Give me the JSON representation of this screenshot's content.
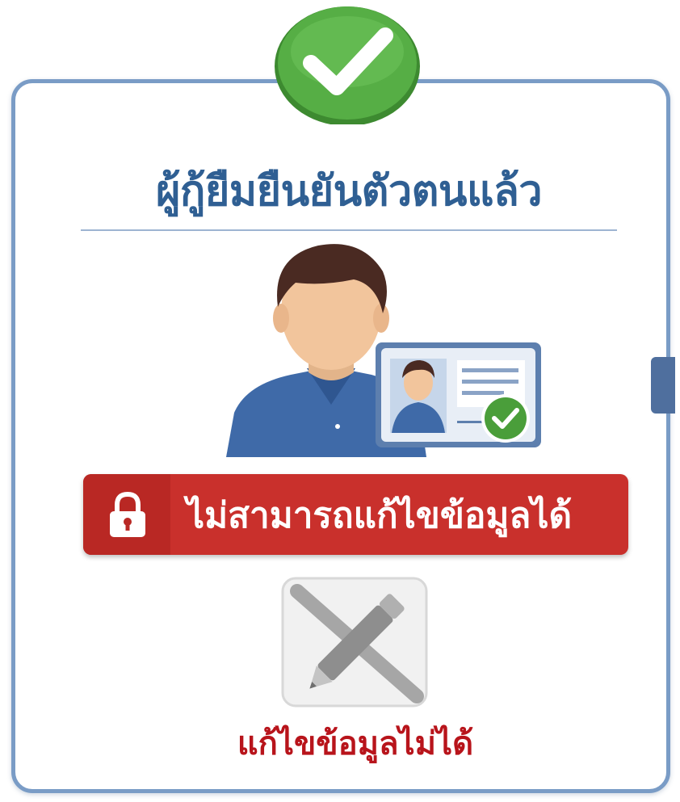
{
  "title": "ผู้กู้ยืมยืนยันตัวตนแล้ว",
  "banner": {
    "text": "ไม่สามารถแก้ไขข้อมูลได้",
    "icon": "lock-icon"
  },
  "bottom_label": "แก้ไขข้อมูลไม่ได้",
  "icons": {
    "badge": "checkmark-circle-icon",
    "illustration": "verified-person-id-card-icon",
    "no_edit": "pencil-crossed-out-icon"
  },
  "colors": {
    "title": "#2f5f93",
    "card_border": "#7a9cc6",
    "badge_green": "#4a9e3a",
    "banner_red": "#c9302c",
    "bottom_label_red": "#b8141b",
    "disabled_gray": "#9a9a9a"
  }
}
